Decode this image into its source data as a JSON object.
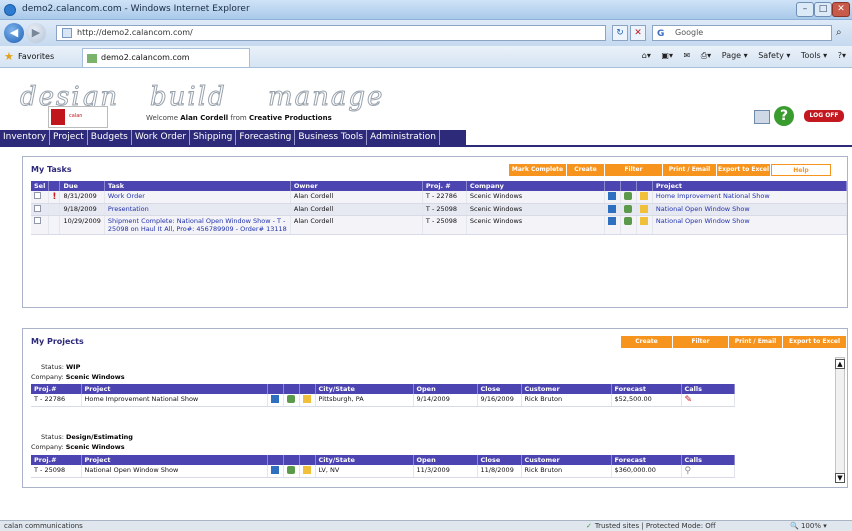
{
  "browser": {
    "title": "demo2.calancom.com - Windows Internet Explorer",
    "url": "http://demo2.calancom.com/",
    "search_provider": "Google",
    "favorites_label": "Favorites",
    "tab_title": "demo2.calancom.com",
    "commands": [
      "Page ▾",
      "Safety ▾",
      "Tools ▾"
    ]
  },
  "app": {
    "taglines": [
      "design",
      "build",
      "manage"
    ],
    "logo_text": "calan",
    "welcome_prefix": "Welcome",
    "user_name": "Alan Cordell",
    "from_label": "from",
    "company_name": "Creative Productions",
    "logoff_label": "LOG OFF",
    "nav": [
      "Inventory",
      "Project",
      "Budgets",
      "Work Order",
      "Shipping",
      "Forecasting",
      "Business Tools",
      "Administration"
    ]
  },
  "tasks": {
    "title": "My Tasks",
    "actions": [
      "Mark Complete",
      "Create",
      "Filter",
      "Print / Email",
      "Export to Excel",
      "Help"
    ],
    "columns": [
      "Sel",
      "",
      "Due",
      "Task",
      "Owner",
      "Proj. #",
      "Company",
      "",
      "",
      "",
      "Project"
    ],
    "rows": [
      {
        "flag": "!",
        "due": "8/31/2009",
        "task": "Work Order",
        "owner": "Alan Cordell",
        "proj": "T - 22786",
        "company": "Scenic Windows",
        "project": "Home Improvement National Show"
      },
      {
        "flag": "",
        "due": "9/18/2009",
        "task": "Presentation",
        "owner": "Alan Cordell",
        "proj": "T - 25098",
        "company": "Scenic Windows",
        "project": "National Open Window Show"
      },
      {
        "flag": "",
        "due": "10/29/2009",
        "task": "Shipment Complete: National Open Window Show - T - 25098 on Haul It All, Pro#: 456789909 - Order# 13118",
        "owner": "Alan Cordell",
        "proj": "T - 25098",
        "company": "Scenic Windows",
        "project": "National Open Window Show"
      }
    ]
  },
  "projects": {
    "title": "My Projects",
    "actions": [
      "Create",
      "Filter",
      "Print / Email",
      "Export to Excel"
    ],
    "columns": [
      "Proj.#",
      "Project",
      "",
      "",
      "",
      "City/State",
      "Open",
      "Close",
      "Customer",
      "Forecast",
      "Calls"
    ],
    "status_label": "Status:",
    "company_label": "Company:",
    "groups": [
      {
        "status": "WIP",
        "company": "Scenic Windows",
        "row": {
          "proj": "T - 22786",
          "project": "Home Improvement National Show",
          "city": "Pittsburgh, PA",
          "open": "9/14/2009",
          "close": "9/16/2009",
          "customer": "Rick Bruton",
          "forecast": "$52,500.00",
          "calls_icon": "phone-red-icon"
        }
      },
      {
        "status": "Design/Estimating",
        "company": "Scenic Windows",
        "row": {
          "proj": "T - 25098",
          "project": "National Open Window Show",
          "city": "LV, NV",
          "open": "11/3/2009",
          "close": "11/8/2009",
          "customer": "Rick Bruton",
          "forecast": "$360,000.00",
          "calls_icon": "magnifier-icon"
        }
      }
    ]
  },
  "statusbar": {
    "left": "calan communications",
    "zone": "Trusted sites | Protected Mode: Off",
    "zoom": "100%"
  },
  "colors": {
    "nav": "#2e2a7a",
    "header_row": "#4c44b0",
    "action": "#f7941d",
    "logoff": "#c3181f"
  }
}
